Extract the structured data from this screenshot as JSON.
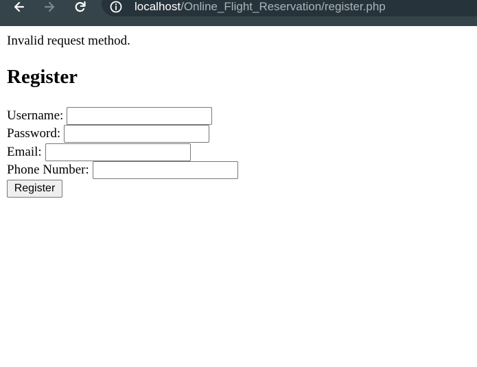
{
  "browser": {
    "url_host": "localhost",
    "url_path": "/Online_Flight_Reservation/register.php",
    "icons": {
      "back": "arrow-left-icon",
      "forward": "arrow-right-icon",
      "reload": "reload-icon",
      "site_info": "info-icon"
    },
    "colors": {
      "toolbar": "#35434a",
      "urlbar": "#27333a",
      "url_host": "#ffffff",
      "url_path": "#aab4ba",
      "forward_disabled": "#7d888e"
    }
  },
  "page": {
    "message": "Invalid request method.",
    "title": "Register",
    "form": {
      "username_label": "Username:",
      "username_value": "",
      "password_label": "Password:",
      "password_value": "",
      "email_label": "Email:",
      "email_value": "",
      "phone_label": "Phone Number:",
      "phone_value": "",
      "submit_label": "Register"
    }
  }
}
